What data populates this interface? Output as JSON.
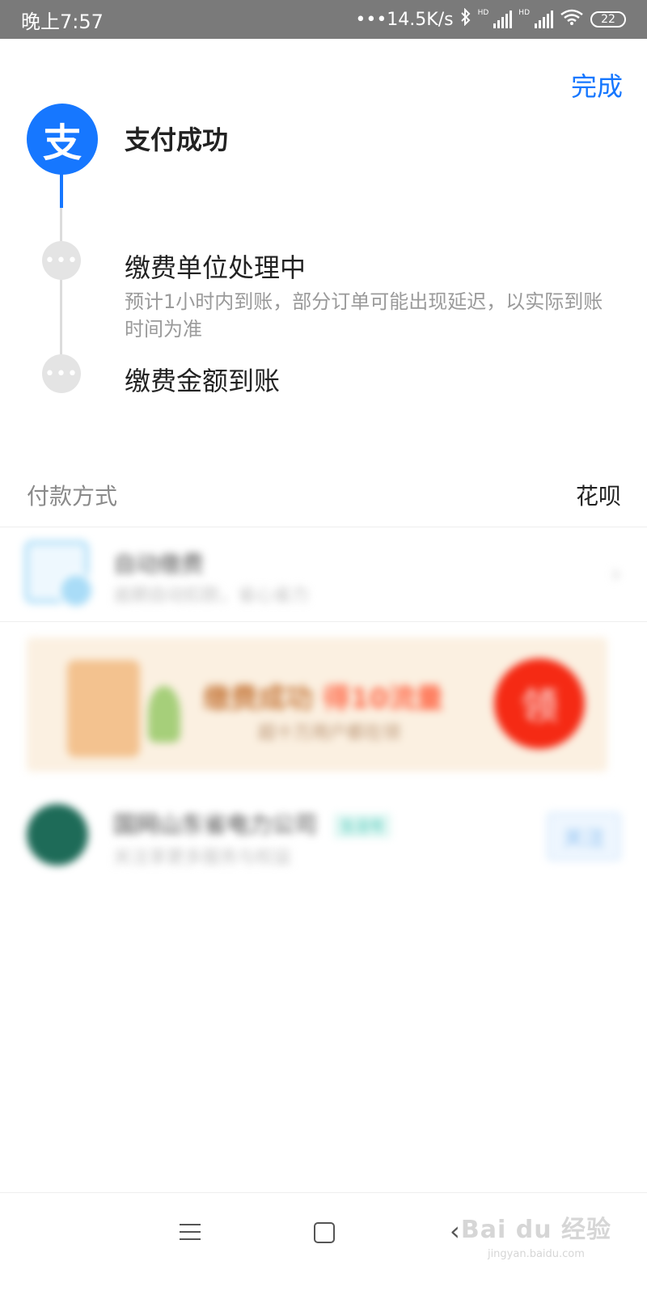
{
  "status_bar": {
    "time": "晚上7:57",
    "network_speed": "•••14.5K/s",
    "bluetooth_icon": "bluetooth-icon",
    "hd_label": "HD",
    "wifi_icon": "wifi-icon",
    "battery": "22"
  },
  "header": {
    "done_label": "完成"
  },
  "logo": {
    "glyph": "支",
    "color": "#1677ff"
  },
  "timeline": {
    "steps": [
      {
        "title": "支付成功"
      },
      {
        "title": "缴费单位处理中",
        "description": "预计1小时内到账，部分订单可能出现延迟，以实际到账时间为准",
        "dot": "•••"
      },
      {
        "title": "缴费金额到账",
        "dot": "•••"
      }
    ]
  },
  "payment": {
    "label": "付款方式",
    "value": "花呗"
  },
  "auto_pay": {
    "title": "自动缴费",
    "subtitle": "逾期自动扣款，省心省力",
    "chevron": "›"
  },
  "banner": {
    "title_main": "缴费成功",
    "title_highlight": "得10流量",
    "subtitle": "超十万用户都在领",
    "claim_label": "领"
  },
  "account": {
    "name": "国网山东省电力公司",
    "tag": "生活号",
    "subtitle": "关注享更多服务与权益",
    "follow_label": "关注"
  },
  "nav_bar": {
    "back_glyph": "‹"
  },
  "watermark": {
    "main": "Bai du 经验",
    "sub": "jingyan.baidu.com"
  }
}
